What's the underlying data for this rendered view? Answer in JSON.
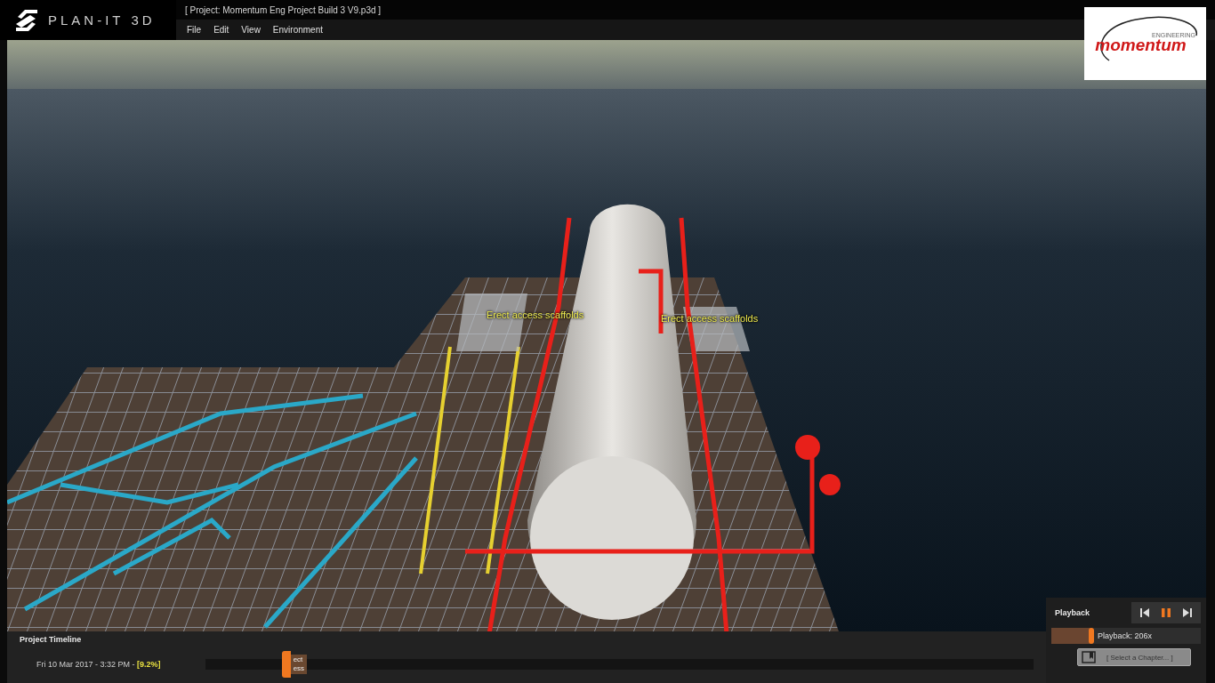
{
  "app": {
    "name": "PLAN-IT 3D",
    "project_title": "[ Project: Momentum Eng Project Build 3 V9.p3d ]"
  },
  "menu": [
    "File",
    "Edit",
    "View",
    "Environment"
  ],
  "brand_logo": {
    "name": "momentum",
    "tagline": "ENGINEERING"
  },
  "viewport": {
    "labels": [
      {
        "text": "Erect access scaffolds"
      },
      {
        "text": "Erect access scaffolds"
      }
    ]
  },
  "timeline": {
    "title": "Project Timeline",
    "datetime": "Fri 10 Mar 2017 - 3:32 PM - ",
    "percent": "[9.2%]",
    "level": 0.092,
    "marker_label": [
      "ect",
      "ess"
    ]
  },
  "playback": {
    "title": "Playback",
    "playing": true,
    "speed_label": "Playback: 206x",
    "level": 0.27,
    "chapter_button": "[ Select a Chapter... ]"
  }
}
